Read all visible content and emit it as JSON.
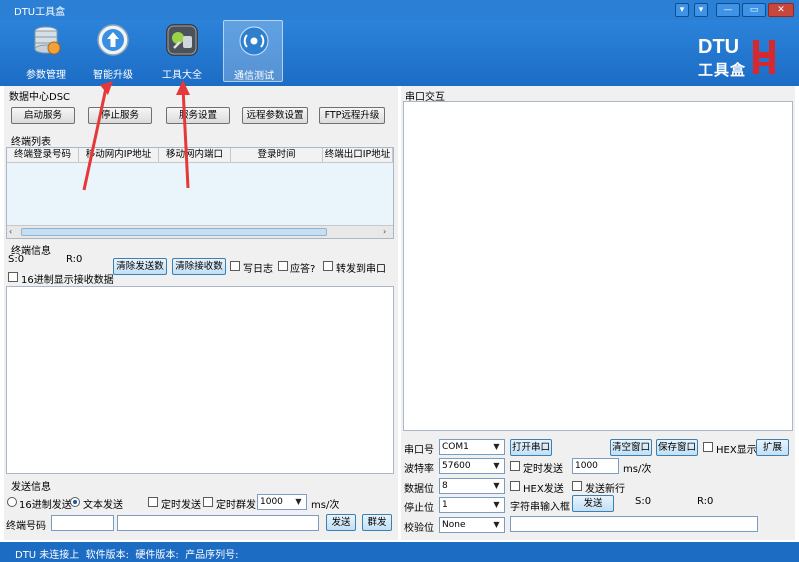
{
  "window": {
    "title": "DTU工具盒",
    "controls": [
      "▾",
      "—",
      "▭",
      "✕"
    ]
  },
  "toolbar": {
    "tools": [
      {
        "label": "参数管理",
        "icon": "database-icon"
      },
      {
        "label": "智能升级",
        "icon": "upgrade-arrow-icon"
      },
      {
        "label": "工具大全",
        "icon": "toolbox-icon"
      },
      {
        "label": "通信测试",
        "icon": "signal-icon"
      }
    ],
    "logo_text": "DTU",
    "logo_sub": "工具盒"
  },
  "dsc": {
    "section_title": "数据中心DSC",
    "buttons": [
      "启动服务",
      "停止服务",
      "服务设置",
      "远程参数设置",
      "FTP远程升级"
    ]
  },
  "terminal_list": {
    "title": "终端列表",
    "columns": [
      "终端登录号码",
      "移动网内IP地址",
      "移动网内端口",
      "登录时间",
      "终端出口IP地址"
    ]
  },
  "terminal_info": {
    "title": "终端信息",
    "send_count": "S:0",
    "recv_count": "R:0",
    "clear_send": "清除发送数",
    "clear_recv": "清除接收数",
    "write_log": "写日志",
    "reply": "应答?",
    "forward_serial": "转发到串口",
    "hex_display": "16进制显示接收数据"
  },
  "send_info": {
    "title": "发送信息",
    "hex_send": "16进制发送",
    "text_send": "文本发送",
    "timed_send": "定时发送",
    "timed_group": "定时群发",
    "interval": "1000",
    "unit": "ms/次",
    "terminal_no": "终端号码",
    "send_btn": "发送",
    "group_btn": "群发"
  },
  "serial": {
    "title": "串口交互",
    "port_label": "串口号",
    "port_value": "COM1",
    "open_btn": "打开串口",
    "clear_btn": "清空窗口",
    "save_btn": "保存窗口",
    "hex_show": "HEX显示",
    "expand_btn": "扩展",
    "baud_label": "波特率",
    "baud_value": "57600",
    "timed_send": "定时发送",
    "interval": "1000",
    "unit": "ms/次",
    "databits_label": "数据位",
    "databits_value": "8",
    "hex_send": "HEX发送",
    "send_newline": "发送新行",
    "stopbits_label": "停止位",
    "stopbits_value": "1",
    "string_input": "字符串输入框",
    "send_btn": "发送",
    "s_count": "S:0",
    "r_count": "R:0",
    "parity_label": "校验位",
    "parity_value": "None"
  },
  "status": {
    "text": "DTU 未连接上  软件版本:  硬件版本:  产品序列号:"
  },
  "colors": {
    "titlebar": "#2b7fd4",
    "toolbar": "#1c6cc4",
    "annotation_arrow": "#e53939"
  }
}
